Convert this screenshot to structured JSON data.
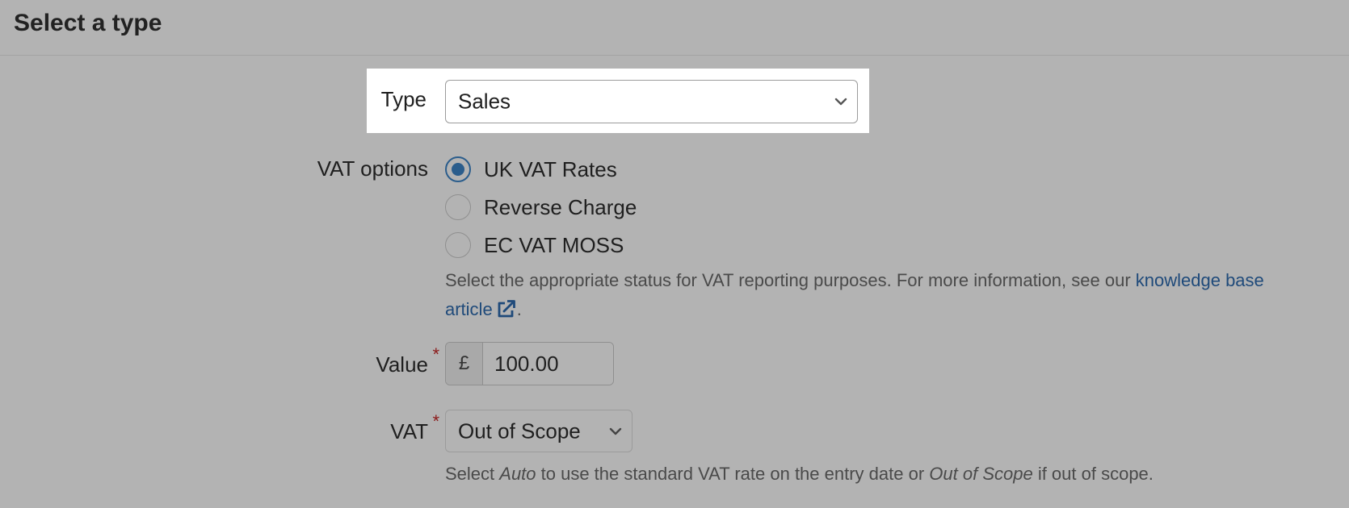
{
  "header": {
    "title": "Select a type"
  },
  "type_field": {
    "label": "Type",
    "selected": "Sales"
  },
  "vat_options": {
    "label": "VAT options",
    "options": [
      {
        "label": "UK VAT Rates",
        "checked": true
      },
      {
        "label": "Reverse Charge",
        "checked": false
      },
      {
        "label": "EC VAT MOSS",
        "checked": false
      }
    ],
    "help_text": "Select the appropriate status for VAT reporting purposes. For more information, see our ",
    "help_link_part1": "knowledge base",
    "help_link_part2": "article",
    "help_end": "."
  },
  "value_field": {
    "label": "Value",
    "required": "*",
    "currency": "£",
    "amount": "100.00"
  },
  "vat_field": {
    "label": "VAT",
    "required": "*",
    "selected": "Out of Scope",
    "help_prefix": "Select ",
    "help_auto": "Auto",
    "help_middle": " to use the standard VAT rate on the entry date or ",
    "help_oos": "Out of Scope",
    "help_suffix": " if out of scope."
  },
  "colors": {
    "accent": "#2b5d8c",
    "link": "#1f4a7a",
    "required": "#8b1a1a",
    "overlay": "#b3b3b3"
  },
  "icons": {
    "chevron": "chevron-down-icon",
    "external": "external-link-icon"
  }
}
